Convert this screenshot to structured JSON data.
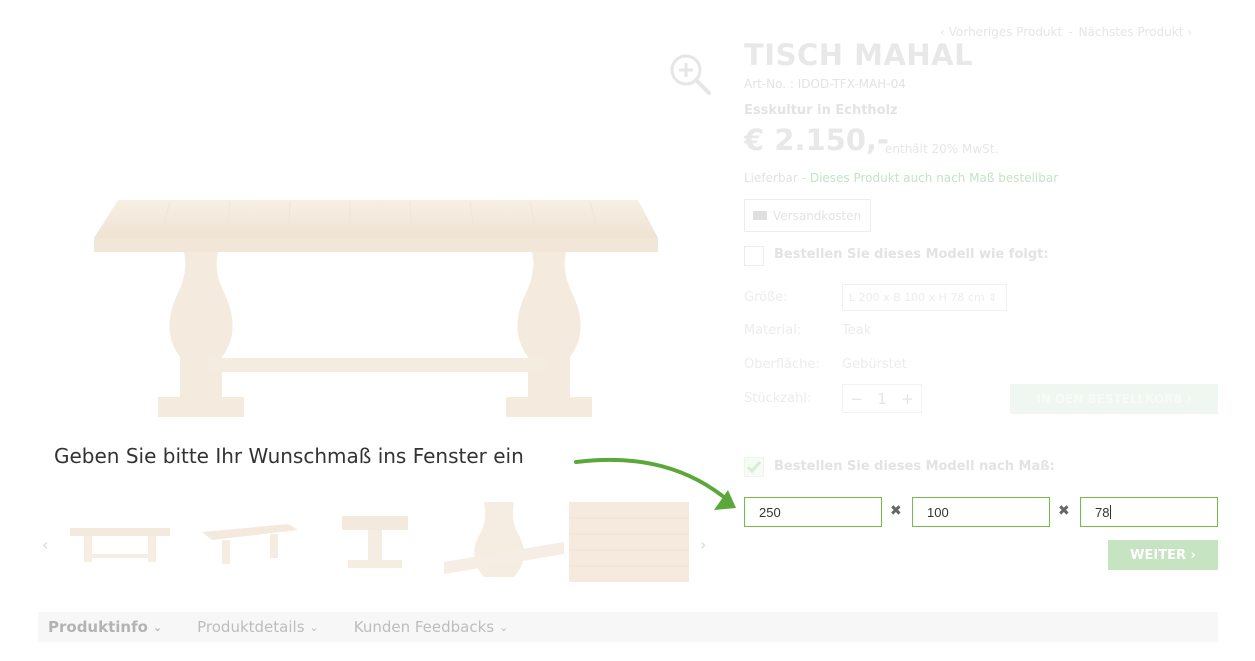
{
  "nav": {
    "prev": "‹ Vorheriges Produkt",
    "separator": "-",
    "next": "Nächstes Produkt ›"
  },
  "product": {
    "title": "TISCH MAHAL",
    "art_no": "Art-No. : IDOD-TFX-MAH-04",
    "subtitle": "Esskultur in Echtholz",
    "price": "€ 2.150,-",
    "vat": "enthält 20% MwSt.",
    "availability": "Lieferbar -",
    "custom_link": "Dieses Produkt auch nach Maß bestellbar",
    "shipping_label": "Versandkosten"
  },
  "order_standard": {
    "label": "Bestellen Sie dieses Modell wie folgt:",
    "size_label": "Größe:",
    "size_value": "L 200 x B 100 x H 78 cm ⇕",
    "material_label": "Material:",
    "material_value": "Teak",
    "surface_label": "Oberfläche:",
    "surface_value": "Gebürstet",
    "qty_label": "Stückzahl:",
    "qty_minus": "−",
    "qty_value": "1",
    "qty_plus": "+",
    "cart_label": "IN DEN BESTELLKORB ›"
  },
  "order_custom": {
    "label": "Bestellen Sie dieses Modell nach Maß:",
    "length": "250",
    "width": "100",
    "height": "78",
    "times": "✖",
    "continue_label": "WEITER ›"
  },
  "annotation": "Geben Sie bitte Ihr Wunschmaß ins Fenster ein",
  "thumbs": {
    "prev": "‹",
    "next": "›"
  },
  "tabs": [
    {
      "label": "Produktinfo"
    },
    {
      "label": "Produktdetails"
    },
    {
      "label": "Kunden Feedbacks"
    }
  ],
  "colors": {
    "accent": "#6fbf4a",
    "annotation_arrow": "#5aa83a",
    "faded_text": "#e3e3e3"
  }
}
